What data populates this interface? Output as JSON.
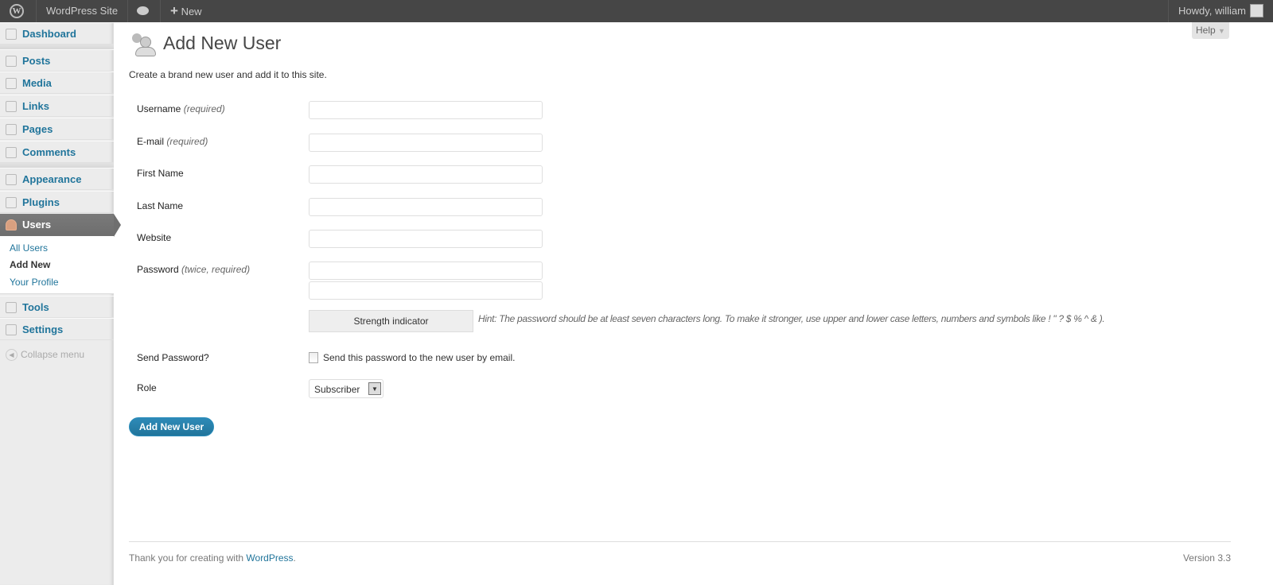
{
  "adminbar": {
    "site": "WordPress Site",
    "new": "New",
    "howdy": "Howdy, william"
  },
  "sidebar": {
    "items": [
      {
        "label": "Dashboard"
      },
      {
        "label": "Posts"
      },
      {
        "label": "Media"
      },
      {
        "label": "Links"
      },
      {
        "label": "Pages"
      },
      {
        "label": "Comments"
      },
      {
        "label": "Appearance"
      },
      {
        "label": "Plugins"
      },
      {
        "label": "Users"
      },
      {
        "label": "Tools"
      },
      {
        "label": "Settings"
      }
    ],
    "submenu": [
      "All Users",
      "Add New",
      "Your Profile"
    ],
    "collapse": "Collapse menu"
  },
  "page": {
    "title": "Add New User",
    "help": "Help",
    "intro": "Create a brand new user and add it to this site."
  },
  "form": {
    "username": {
      "label": "Username",
      "note": "(required)",
      "value": ""
    },
    "email": {
      "label": "E-mail",
      "note": "(required)",
      "value": ""
    },
    "first_name": {
      "label": "First Name",
      "value": ""
    },
    "last_name": {
      "label": "Last Name",
      "value": ""
    },
    "website": {
      "label": "Website",
      "value": ""
    },
    "password": {
      "label": "Password",
      "note": "(twice, required)"
    },
    "strength": "Strength indicator",
    "hint": "Hint: The password should be at least seven characters long. To make it stronger, use upper and lower case letters, numbers and symbols like ! \" ? $ % ^ & ).",
    "send_label": "Send Password?",
    "send_text": "Send this password to the new user by email.",
    "send_checked": false,
    "role_label": "Role",
    "role_value": "Subscriber",
    "submit": "Add New User"
  },
  "footer": {
    "thanks": "Thank you for creating with ",
    "link": "WordPress",
    "period": ".",
    "version": "Version 3.3"
  },
  "colors": {
    "link": "#21759b",
    "adminbar": "#464646",
    "button": "#21759b"
  }
}
